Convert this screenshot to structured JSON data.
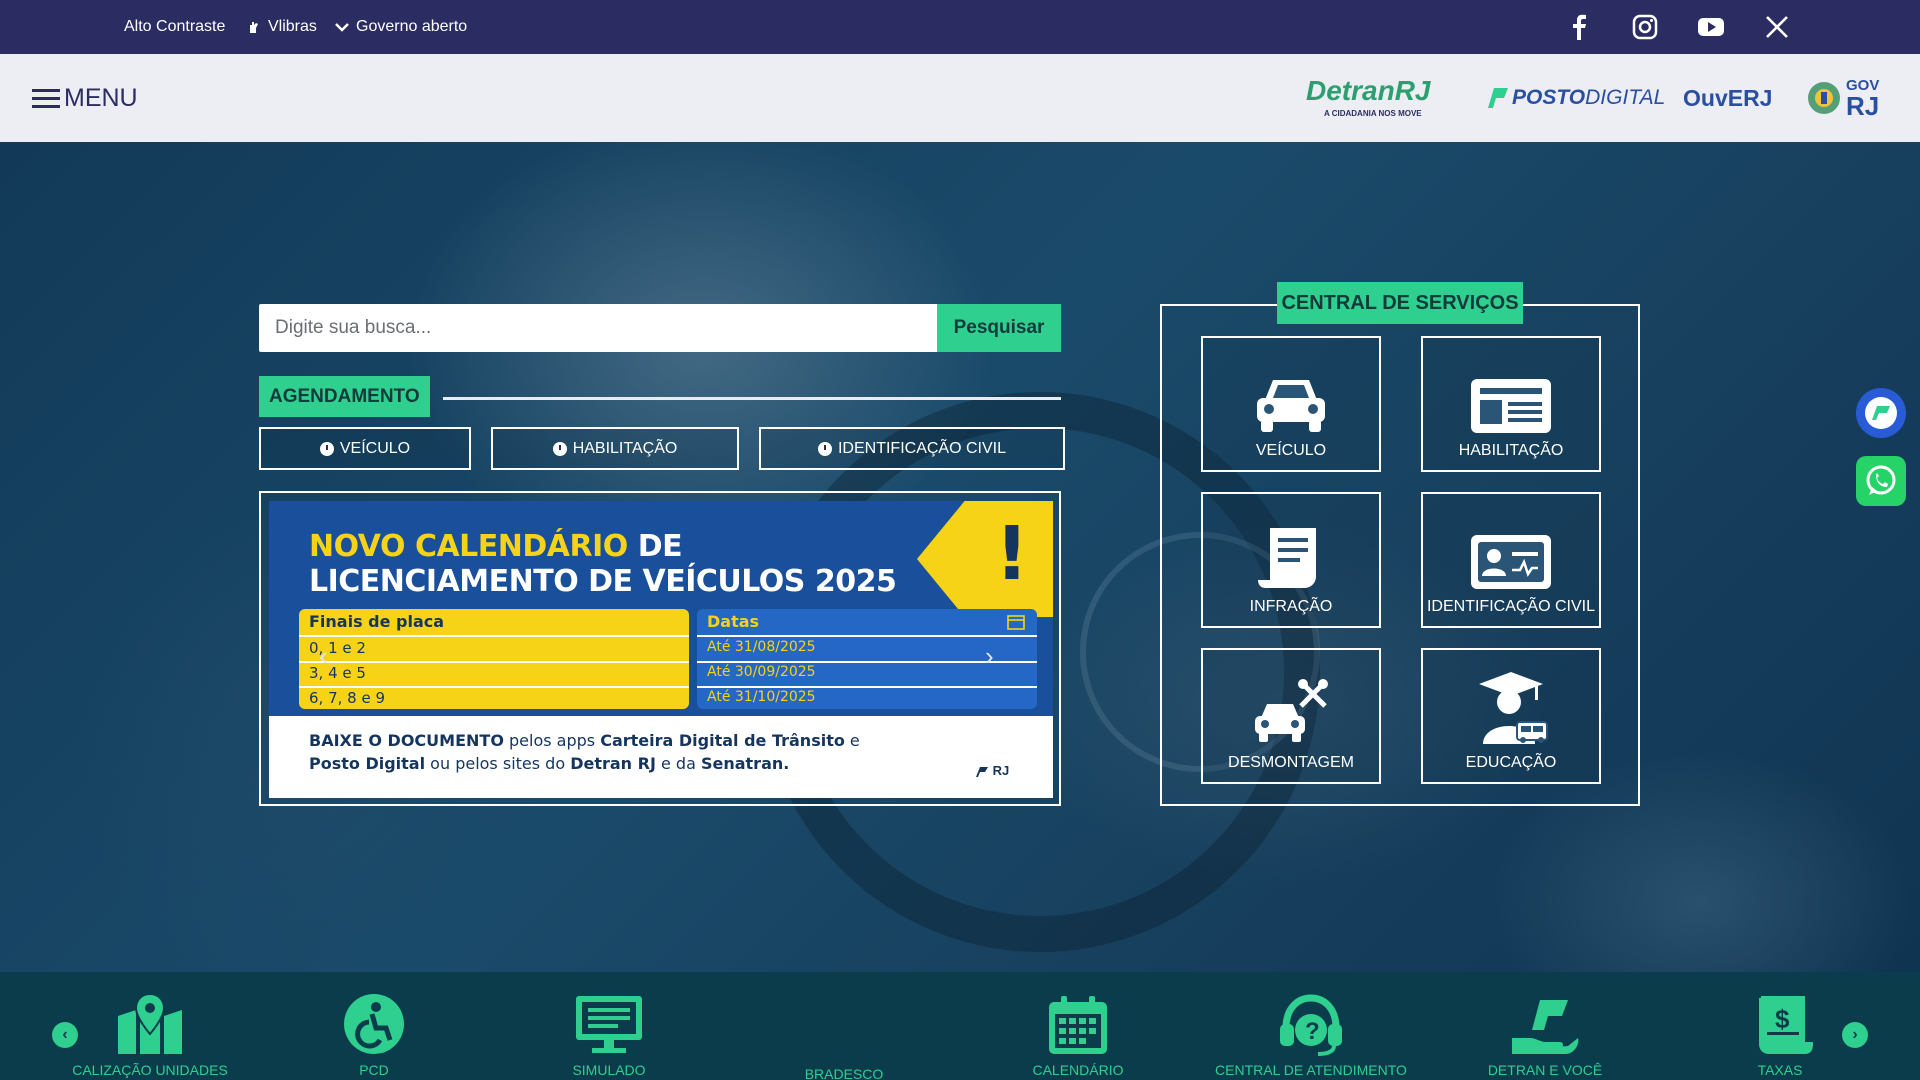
{
  "topbar": {
    "accessibility": {
      "high_contrast": "Alto Contraste",
      "vlibras": "Vlibras",
      "open_gov": "Governo aberto"
    },
    "social_icons": [
      "facebook-icon",
      "instagram-icon",
      "youtube-icon",
      "x-icon"
    ]
  },
  "header": {
    "menu_label": "MENU",
    "logos": {
      "detran_name": "DetranRJ",
      "detran_slogan": "A CIDADANIA NOS MOVE",
      "posto_digital_a": "POSTO",
      "posto_digital_b": "DIGITAL",
      "ouverj": "OuvERJ",
      "govrj_a": "GOV",
      "govrj_b": "RJ"
    }
  },
  "search": {
    "placeholder": "Digite sua busca...",
    "button_label": "Pesquisar"
  },
  "scheduling": {
    "label": "AGENDAMENTO",
    "buttons": [
      "VEÍCULO",
      "HABILITAÇÃO",
      "IDENTIFICAÇÃO CIVIL"
    ]
  },
  "banner": {
    "title_highlight": "NOVO CALENDÁRIO",
    "title_rest": " DE",
    "title_line2": "LICENCIAMENTO DE VEÍCULOS 2025",
    "plate_header": "Finais de placa",
    "plates": [
      "0, 1 e 2",
      "3, 4 e 5",
      "6, 7, 8 e 9"
    ],
    "dates_header": "Datas",
    "dates": [
      "Até 31/08/2025",
      "Até 30/09/2025",
      "Até 31/10/2025"
    ],
    "footer1_bold1": "BAIXE O DOCUMENTO",
    "footer1_text": " pelos apps ",
    "footer1_bold2": "Carteira Digital de Trânsito",
    "footer1_end": " e",
    "footer2_bold1": "Posto Digital",
    "footer2_text": " ou pelos sites do ",
    "footer2_bold2": "Detran RJ",
    "footer2_mid": " e da ",
    "footer2_bold3": "Senatran.",
    "gov_mark": "RJ"
  },
  "services": {
    "title": "CENTRAL DE SERVIÇOS",
    "items": [
      "VEÍCULO",
      "HABILITAÇÃO",
      "INFRAÇÃO",
      "IDENTIFICAÇÃO CIVIL",
      "DESMONTAGEM",
      "EDUCAÇÃO"
    ]
  },
  "shortcuts": [
    "CALIZAÇÃO UNIDADES",
    "PCD",
    "SIMULADO",
    "BRADESCO",
    "CALENDÁRIO",
    "CENTRAL DE ATENDIMENTO",
    "DETRAN E VOCÊ",
    "TAXAS"
  ],
  "colors": {
    "topbar": "#2b2d62",
    "accent_green": "#2ecf8f",
    "bottom_bar": "#0b3c4c"
  }
}
